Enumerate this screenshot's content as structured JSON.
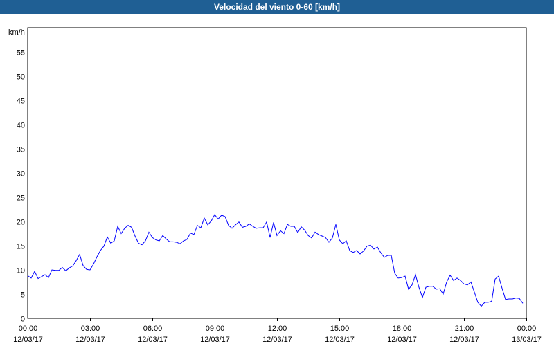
{
  "chart_data": {
    "type": "line",
    "title": "Velocidad del viento 0-60 [km/h]",
    "ylabel": "km/h",
    "ylim": [
      0,
      60
    ],
    "yticks": [
      0,
      5,
      10,
      15,
      20,
      25,
      30,
      35,
      40,
      45,
      50,
      55
    ],
    "xlim_hours": [
      0,
      24
    ],
    "xticks": [
      {
        "time": "00:00",
        "date": "12/03/17"
      },
      {
        "time": "03:00",
        "date": "12/03/17"
      },
      {
        "time": "06:00",
        "date": "12/03/17"
      },
      {
        "time": "09:00",
        "date": "12/03/17"
      },
      {
        "time": "12:00",
        "date": "12/03/17"
      },
      {
        "time": "15:00",
        "date": "12/03/17"
      },
      {
        "time": "18:00",
        "date": "12/03/17"
      },
      {
        "time": "21:00",
        "date": "12/03/17"
      },
      {
        "time": "00:00",
        "date": "13/03/17"
      }
    ],
    "grid": true,
    "interval_minutes": 10,
    "series": [
      {
        "name": "Velocidad del viento",
        "color": "#0000ff",
        "values": [
          8.8,
          8.3,
          9.7,
          8.2,
          8.6,
          9.0,
          8.4,
          10.0,
          9.9,
          9.9,
          10.5,
          9.8,
          10.4,
          10.8,
          11.9,
          13.2,
          10.9,
          10.1,
          10.0,
          11.2,
          12.7,
          14.0,
          14.9,
          16.8,
          15.5,
          16.0,
          19.0,
          17.5,
          18.6,
          19.2,
          18.8,
          17.0,
          15.5,
          15.2,
          16.0,
          17.8,
          16.7,
          16.2,
          16.0,
          17.1,
          16.4,
          15.8,
          15.8,
          15.7,
          15.4,
          16.0,
          16.3,
          17.6,
          17.3,
          19.2,
          18.7,
          20.7,
          19.3,
          20.1,
          21.4,
          20.5,
          21.3,
          21.0,
          19.2,
          18.6,
          19.3,
          19.9,
          18.8,
          19.0,
          19.5,
          19.0,
          18.6,
          18.7,
          18.7,
          19.9,
          16.7,
          19.8,
          17.1,
          18.1,
          17.5,
          19.4,
          19.0,
          19.0,
          17.7,
          18.9,
          18.2,
          17.1,
          16.6,
          17.8,
          17.3,
          17.0,
          16.7,
          15.7,
          16.6,
          19.4,
          16.2,
          15.4,
          16.0,
          14.0,
          13.6,
          14.0,
          13.3,
          13.9,
          14.9,
          15.1,
          14.3,
          14.7,
          13.5,
          12.6,
          13.0,
          13.0,
          9.3,
          8.3,
          8.4,
          8.7,
          6.0,
          6.9,
          9.0,
          6.4,
          4.3,
          6.4,
          6.6,
          6.6,
          6.0,
          6.1,
          5.0,
          7.5,
          8.9,
          7.8,
          8.3,
          7.8,
          7.1,
          6.9,
          7.5,
          5.4,
          3.3,
          2.5,
          3.3,
          3.3,
          3.5,
          8.1,
          8.7,
          6.2,
          3.9,
          4.0,
          4.0,
          4.2,
          4.1,
          3.1
        ]
      }
    ]
  }
}
